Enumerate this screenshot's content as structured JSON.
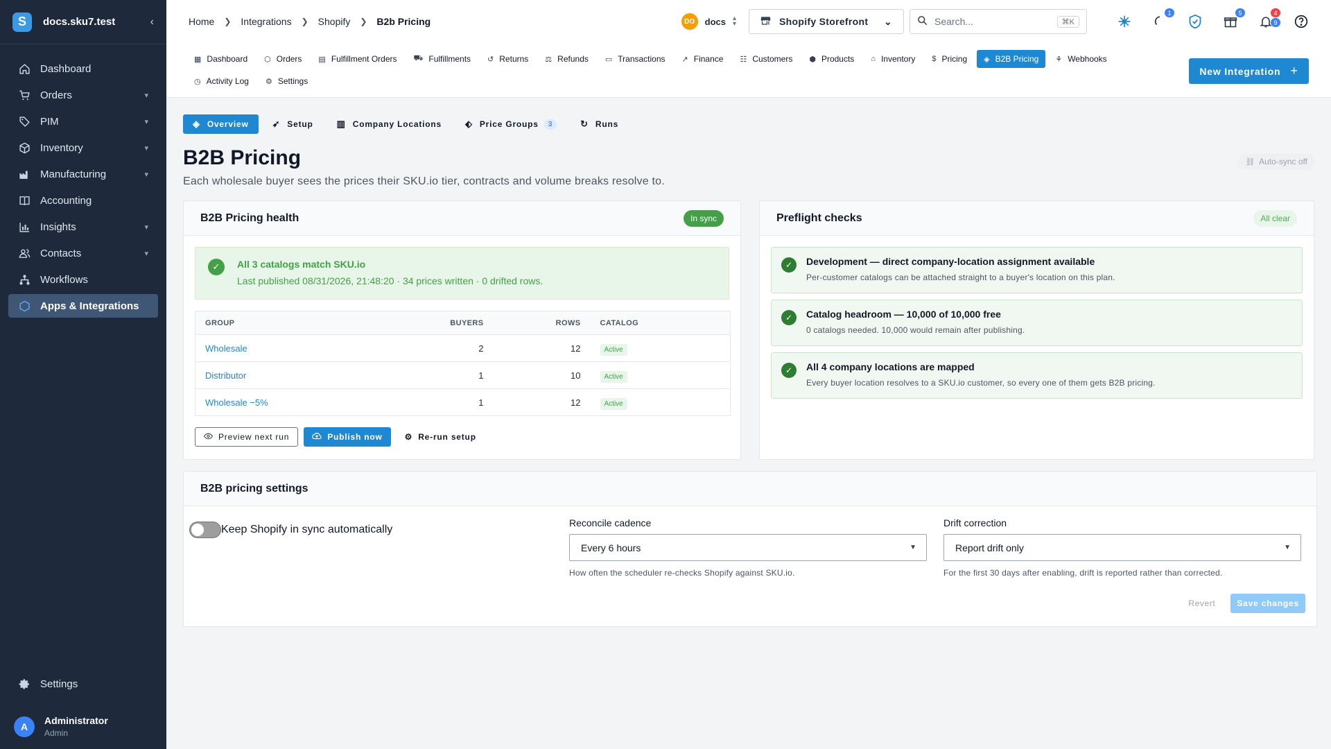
{
  "sidebar": {
    "brand": "docs.sku7.test",
    "items": [
      {
        "label": "Dashboard",
        "icon": "home-icon",
        "has_children": false,
        "active": false
      },
      {
        "label": "Orders",
        "icon": "cart-icon",
        "has_children": true,
        "active": false
      },
      {
        "label": "PIM",
        "icon": "tag-icon",
        "has_children": true,
        "active": false
      },
      {
        "label": "Inventory",
        "icon": "box-icon",
        "has_children": true,
        "active": false
      },
      {
        "label": "Manufacturing",
        "icon": "factory-icon",
        "has_children": true,
        "active": false
      },
      {
        "label": "Accounting",
        "icon": "book-icon",
        "has_children": false,
        "active": false
      },
      {
        "label": "Insights",
        "icon": "chart-icon",
        "has_children": true,
        "active": false
      },
      {
        "label": "Contacts",
        "icon": "people-icon",
        "has_children": true,
        "active": false
      },
      {
        "label": "Workflows",
        "icon": "workflow-icon",
        "has_children": false,
        "active": false
      },
      {
        "label": "Apps & Integrations",
        "icon": "apps-icon",
        "has_children": false,
        "active": true
      }
    ],
    "settings_label": "Settings",
    "user": {
      "initial": "A",
      "name": "Administrator",
      "role": "Admin"
    }
  },
  "header": {
    "breadcrumbs": [
      "Home",
      "Integrations",
      "Shopify",
      "B2b Pricing"
    ],
    "tenant": {
      "initials": "DO",
      "name": "docs"
    },
    "store_selector": "Shopify Storefront",
    "search_placeholder": "Search...",
    "search_shortcut": "⌘K",
    "badges": {
      "activity": "1",
      "gifts": "5",
      "notifications_red": "4",
      "notifications_blue": "9"
    }
  },
  "subnav": {
    "tabs": [
      {
        "label": "Dashboard",
        "icon": "▦"
      },
      {
        "label": "Orders",
        "icon": "⬡"
      },
      {
        "label": "Fulfillment Orders",
        "icon": "▤"
      },
      {
        "label": "Fulfillments",
        "icon": "⛟"
      },
      {
        "label": "Returns",
        "icon": "↺"
      },
      {
        "label": "Refunds",
        "icon": "⚖"
      },
      {
        "label": "Transactions",
        "icon": "▭"
      },
      {
        "label": "Finance",
        "icon": "↗"
      },
      {
        "label": "Customers",
        "icon": "☷"
      },
      {
        "label": "Products",
        "icon": "⬢"
      },
      {
        "label": "Inventory",
        "icon": "⌂"
      },
      {
        "label": "Pricing",
        "icon": "$"
      },
      {
        "label": "B2B Pricing",
        "icon": "◈"
      },
      {
        "label": "Webhooks",
        "icon": "⚘"
      }
    ],
    "tabs_row2": [
      {
        "label": "Activity Log",
        "icon": "◷"
      },
      {
        "label": "Settings",
        "icon": "⚙"
      }
    ],
    "new_integration": "New Integration"
  },
  "page": {
    "tabs": [
      {
        "label": "Overview",
        "icon": "◈"
      },
      {
        "label": "Setup",
        "icon": "➶"
      },
      {
        "label": "Company Locations",
        "icon": "▥"
      },
      {
        "label": "Price Groups",
        "icon": "⬖",
        "count": "3"
      },
      {
        "label": "Runs",
        "icon": "↻"
      }
    ],
    "title": "B2B Pricing",
    "subtitle": "Each wholesale buyer sees the prices their SKU.io tier, contracts and volume breaks resolve to.",
    "autosync": "Auto-sync off"
  },
  "health": {
    "title": "B2B Pricing health",
    "status": "In sync",
    "alert_title": "All 3 catalogs match SKU.io",
    "alert_sub": "Last published 08/31/2026, 21:48:20 · 34 prices written · 0 drifted rows.",
    "columns": [
      "GROUP",
      "BUYERS",
      "ROWS",
      "CATALOG"
    ],
    "rows": [
      {
        "group": "Wholesale",
        "buyers": "2",
        "rows": "12",
        "catalog": "Active"
      },
      {
        "group": "Distributor",
        "buyers": "1",
        "rows": "10",
        "catalog": "Active"
      },
      {
        "group": "Wholesale −5%",
        "buyers": "1",
        "rows": "12",
        "catalog": "Active"
      }
    ],
    "actions": {
      "preview": "Preview next run",
      "publish": "Publish now",
      "rerun": "Re-run setup"
    }
  },
  "preflight": {
    "title": "Preflight checks",
    "status": "All clear",
    "checks": [
      {
        "title": "Development — direct company-location assignment available",
        "sub": "Per-customer catalogs can be attached straight to a buyer's location on this plan."
      },
      {
        "title": "Catalog headroom — 10,000 of 10,000 free",
        "sub": "0 catalogs needed. 10,000 would remain after publishing."
      },
      {
        "title": "All 4 company locations are mapped",
        "sub": "Every buyer location resolves to a SKU.io customer, so every one of them gets B2B pricing."
      }
    ]
  },
  "settings": {
    "title": "B2B pricing settings",
    "toggle_label": "Keep Shopify in sync automatically",
    "cadence": {
      "label": "Reconcile cadence",
      "value": "Every 6 hours",
      "help": "How often the scheduler re-checks Shopify against SKU.io."
    },
    "drift": {
      "label": "Drift correction",
      "value": "Report drift only",
      "help": "For the first 30 days after enabling, drift is reported rather than corrected."
    },
    "revert": "Revert",
    "save": "Save changes"
  }
}
